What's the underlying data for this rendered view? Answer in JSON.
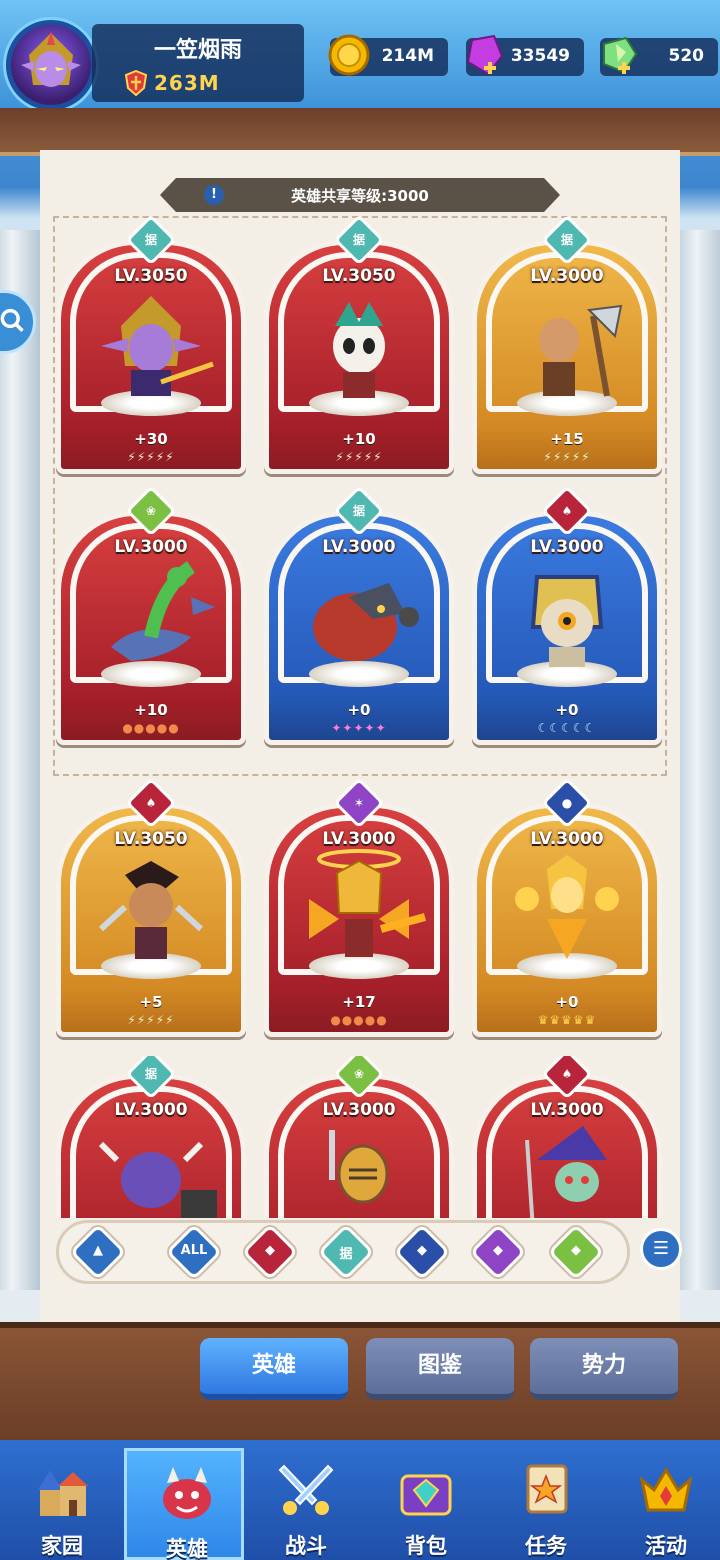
{
  "player": {
    "name": "一笠烟雨",
    "power": "263M"
  },
  "resources": [
    {
      "id": "gold",
      "icon": "gold-coin-icon",
      "value": "214M"
    },
    {
      "id": "gem",
      "icon": "purple-gem-icon",
      "value": "33549"
    },
    {
      "id": "crystal",
      "icon": "green-crystal-icon",
      "value": "520"
    }
  ],
  "shared_level": {
    "label": "英雄共享等级:3000",
    "info_icon": "!"
  },
  "heroes": [
    {
      "level": "LV.3050",
      "plus": "+30",
      "frame": "red",
      "faction": "teal",
      "faction_icon": "据",
      "stars": "⚡⚡⚡⚡⚡",
      "star_color": "#e8f2c8",
      "portrait": "elf-assassin"
    },
    {
      "level": "LV.3050",
      "plus": "+10",
      "frame": "red",
      "faction": "teal",
      "faction_icon": "据",
      "stars": "⚡⚡⚡⚡⚡",
      "star_color": "#e8f2c8",
      "portrait": "panda-warrior"
    },
    {
      "level": "LV.3000",
      "plus": "+15",
      "frame": "gold",
      "faction": "teal",
      "faction_icon": "据",
      "stars": "⚡⚡⚡⚡⚡",
      "star_color": "#e8f2c8",
      "portrait": "axe-barbarian"
    },
    {
      "level": "LV.3000",
      "plus": "+10",
      "frame": "red",
      "faction": "green",
      "faction_icon": "❀",
      "stars": "●●●●●",
      "star_color": "#f08a4b",
      "portrait": "dragon-tree"
    },
    {
      "level": "LV.3000",
      "plus": "+0",
      "frame": "blue",
      "faction": "teal",
      "faction_icon": "据",
      "stars": "✦✦✦✦✦",
      "star_color": "#ff7ad9",
      "portrait": "lava-beast"
    },
    {
      "level": "LV.3000",
      "plus": "+0",
      "frame": "blue",
      "faction": "darkred",
      "faction_icon": "♠",
      "stars": "☾☾☾☾☾",
      "star_color": "#bfe3ff",
      "portrait": "pharaoh-mummy"
    },
    {
      "level": "LV.3050",
      "plus": "+5",
      "frame": "gold",
      "faction": "darkred",
      "faction_icon": "♠",
      "stars": "⚡⚡⚡⚡⚡",
      "star_color": "#e8f2c8",
      "portrait": "blade-samurai"
    },
    {
      "level": "LV.3000",
      "plus": "+17",
      "frame": "red",
      "faction": "purple",
      "faction_icon": "✶",
      "stars": "●●●●●",
      "star_color": "#f08a4b",
      "portrait": "flame-knight"
    },
    {
      "level": "LV.3000",
      "plus": "+0",
      "frame": "gold",
      "faction": "navy",
      "faction_icon": "●",
      "stars": "♛♛♛♛♛",
      "star_color": "#ffd34d",
      "portrait": "light-goddess"
    },
    {
      "level": "LV.3000",
      "plus": "",
      "frame": "red",
      "faction": "teal",
      "faction_icon": "据",
      "stars": "",
      "star_color": "#fff",
      "portrait": "minotaur"
    },
    {
      "level": "LV.3000",
      "plus": "",
      "frame": "red",
      "faction": "green",
      "faction_icon": "❀",
      "stars": "",
      "star_color": "#fff",
      "portrait": "golden-knight"
    },
    {
      "level": "LV.3000",
      "plus": "",
      "frame": "red",
      "faction": "darkred",
      "faction_icon": "♠",
      "stars": "",
      "star_color": "#fff",
      "portrait": "zombie-wizard"
    }
  ],
  "filters": [
    {
      "id": "up",
      "label": "",
      "color": "#2f6fc2",
      "icon": "arrow-up-icon"
    },
    {
      "id": "all",
      "label": "ALL",
      "color": "#2f6fc2",
      "icon": ""
    },
    {
      "id": "darkred",
      "label": "",
      "color": "#b8253a",
      "icon": "bat-icon"
    },
    {
      "id": "teal",
      "label": "据",
      "color": "#4fb8b0",
      "icon": ""
    },
    {
      "id": "navy",
      "label": "",
      "color": "#2b4fa8",
      "icon": "orb-icon"
    },
    {
      "id": "purple",
      "label": "",
      "color": "#8e44c4",
      "icon": "wings-icon"
    },
    {
      "id": "green",
      "label": "",
      "color": "#7bc043",
      "icon": "lotus-icon"
    }
  ],
  "tabs": [
    "英雄",
    "图鉴",
    "势力"
  ],
  "nav": [
    "家园",
    "英雄",
    "战斗",
    "背包",
    "任务",
    "活动"
  ]
}
